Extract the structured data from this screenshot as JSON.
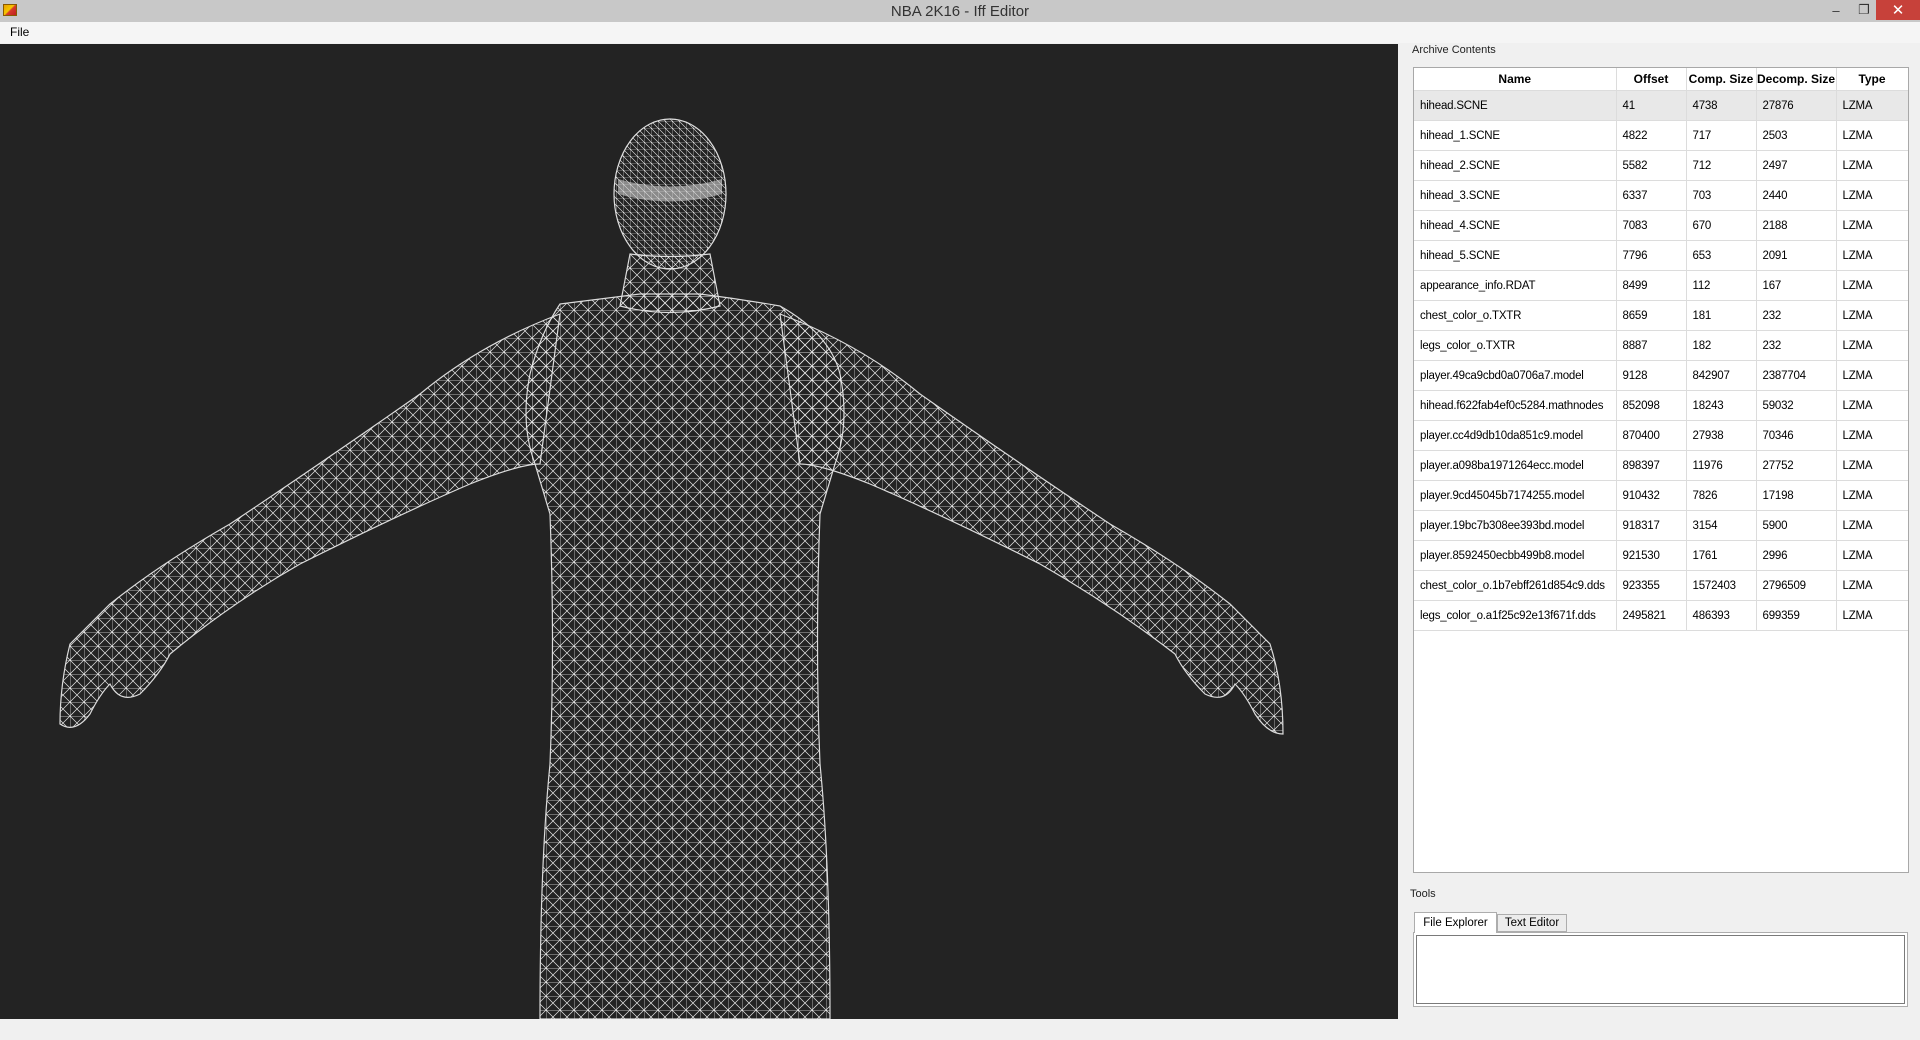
{
  "window": {
    "title": "NBA 2K16 - Iff Editor",
    "minimize": "–",
    "maximize": "❐",
    "close": "✕"
  },
  "menu": {
    "file": "File"
  },
  "viewport": {
    "content": "wireframe-player-model"
  },
  "archive": {
    "group_title": "Archive Contents",
    "columns": [
      "Name",
      "Offset",
      "Comp. Size",
      "Decomp. Size",
      "Type"
    ],
    "rows": [
      [
        "hihead.SCNE",
        "41",
        "4738",
        "27876",
        "LZMA"
      ],
      [
        "hihead_1.SCNE",
        "4822",
        "717",
        "2503",
        "LZMA"
      ],
      [
        "hihead_2.SCNE",
        "5582",
        "712",
        "2497",
        "LZMA"
      ],
      [
        "hihead_3.SCNE",
        "6337",
        "703",
        "2440",
        "LZMA"
      ],
      [
        "hihead_4.SCNE",
        "7083",
        "670",
        "2188",
        "LZMA"
      ],
      [
        "hihead_5.SCNE",
        "7796",
        "653",
        "2091",
        "LZMA"
      ],
      [
        "appearance_info.RDAT",
        "8499",
        "112",
        "167",
        "LZMA"
      ],
      [
        "chest_color_o.TXTR",
        "8659",
        "181",
        "232",
        "LZMA"
      ],
      [
        "legs_color_o.TXTR",
        "8887",
        "182",
        "232",
        "LZMA"
      ],
      [
        "player.49ca9cbd0a0706a7.model",
        "9128",
        "842907",
        "2387704",
        "LZMA"
      ],
      [
        "hihead.f622fab4ef0c5284.mathnodes",
        "852098",
        "18243",
        "59032",
        "LZMA"
      ],
      [
        "player.cc4d9db10da851c9.model",
        "870400",
        "27938",
        "70346",
        "LZMA"
      ],
      [
        "player.a098ba1971264ecc.model",
        "898397",
        "11976",
        "27752",
        "LZMA"
      ],
      [
        "player.9cd45045b7174255.model",
        "910432",
        "7826",
        "17198",
        "LZMA"
      ],
      [
        "player.19bc7b308ee393bd.model",
        "918317",
        "3154",
        "5900",
        "LZMA"
      ],
      [
        "player.8592450ecbb499b8.model",
        "921530",
        "1761",
        "2996",
        "LZMA"
      ],
      [
        "chest_color_o.1b7ebff261d854c9.dds",
        "923355",
        "1572403",
        "2796509",
        "LZMA"
      ],
      [
        "legs_color_o.a1f25c92e13f671f.dds",
        "2495821",
        "486393",
        "699359",
        "LZMA"
      ]
    ]
  },
  "tools": {
    "group_title": "Tools",
    "tabs": [
      "File Explorer",
      "Text Editor"
    ]
  },
  "colors": {
    "viewport_bg": "#232323",
    "wire": "#e6e6e6",
    "close_btn": "#c7413a"
  }
}
